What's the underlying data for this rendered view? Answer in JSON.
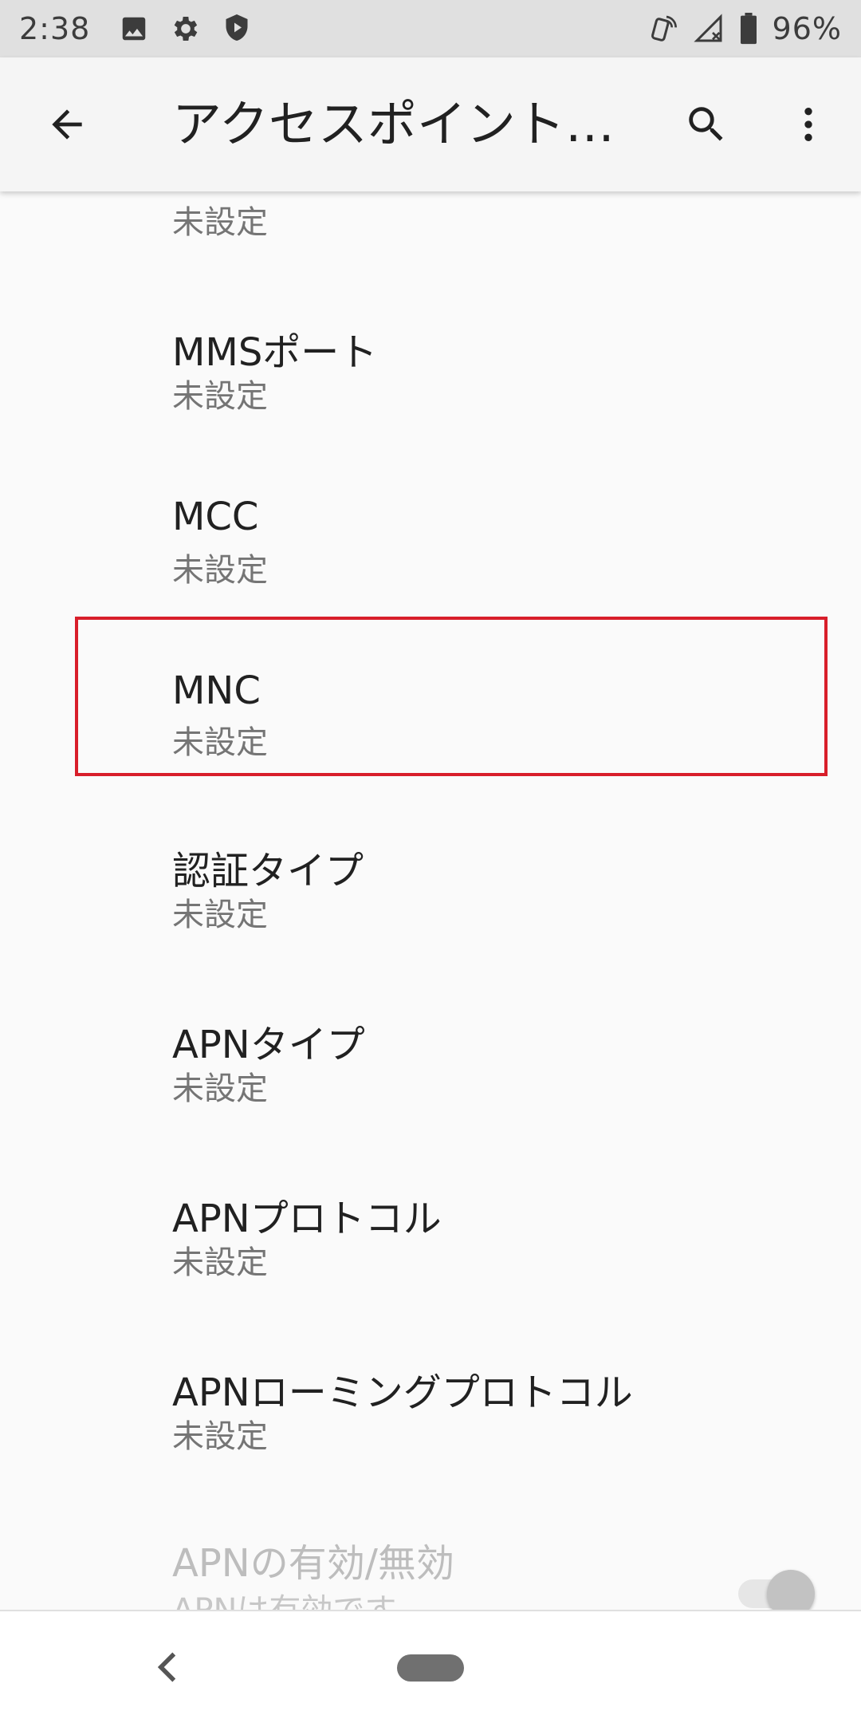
{
  "status_bar": {
    "time": "2:38",
    "battery_percent": "96%",
    "icons_left": [
      "image-icon",
      "gear-icon",
      "shield-icon"
    ],
    "icons_right": [
      "nfc-icon",
      "signal-no-service-icon",
      "battery-icon"
    ]
  },
  "app_bar": {
    "title": "アクセスポイント…",
    "icons": [
      "back-arrow-icon",
      "search-icon",
      "more-vert-icon"
    ]
  },
  "preferences": [
    {
      "title": "",
      "summary": "未設定"
    },
    {
      "title": "MMSポート",
      "summary": "未設定"
    },
    {
      "title": "MCC",
      "summary": "未設定"
    },
    {
      "title": "MNC",
      "summary": "未設定"
    },
    {
      "title": "認証タイプ",
      "summary": "未設定"
    },
    {
      "title": "APNタイプ",
      "summary": "未設定"
    },
    {
      "title": "APNプロトコル",
      "summary": "未設定"
    },
    {
      "title": "APNローミングプロトコル",
      "summary": "未設定"
    },
    {
      "title": "APNの有効/無効",
      "summary": "APNは有効です",
      "enabled": false,
      "toggle_on": true
    }
  ],
  "colors": {
    "highlight": "#d81e2a",
    "background": "#fafafa",
    "app_bar": "#f5f5f5"
  }
}
